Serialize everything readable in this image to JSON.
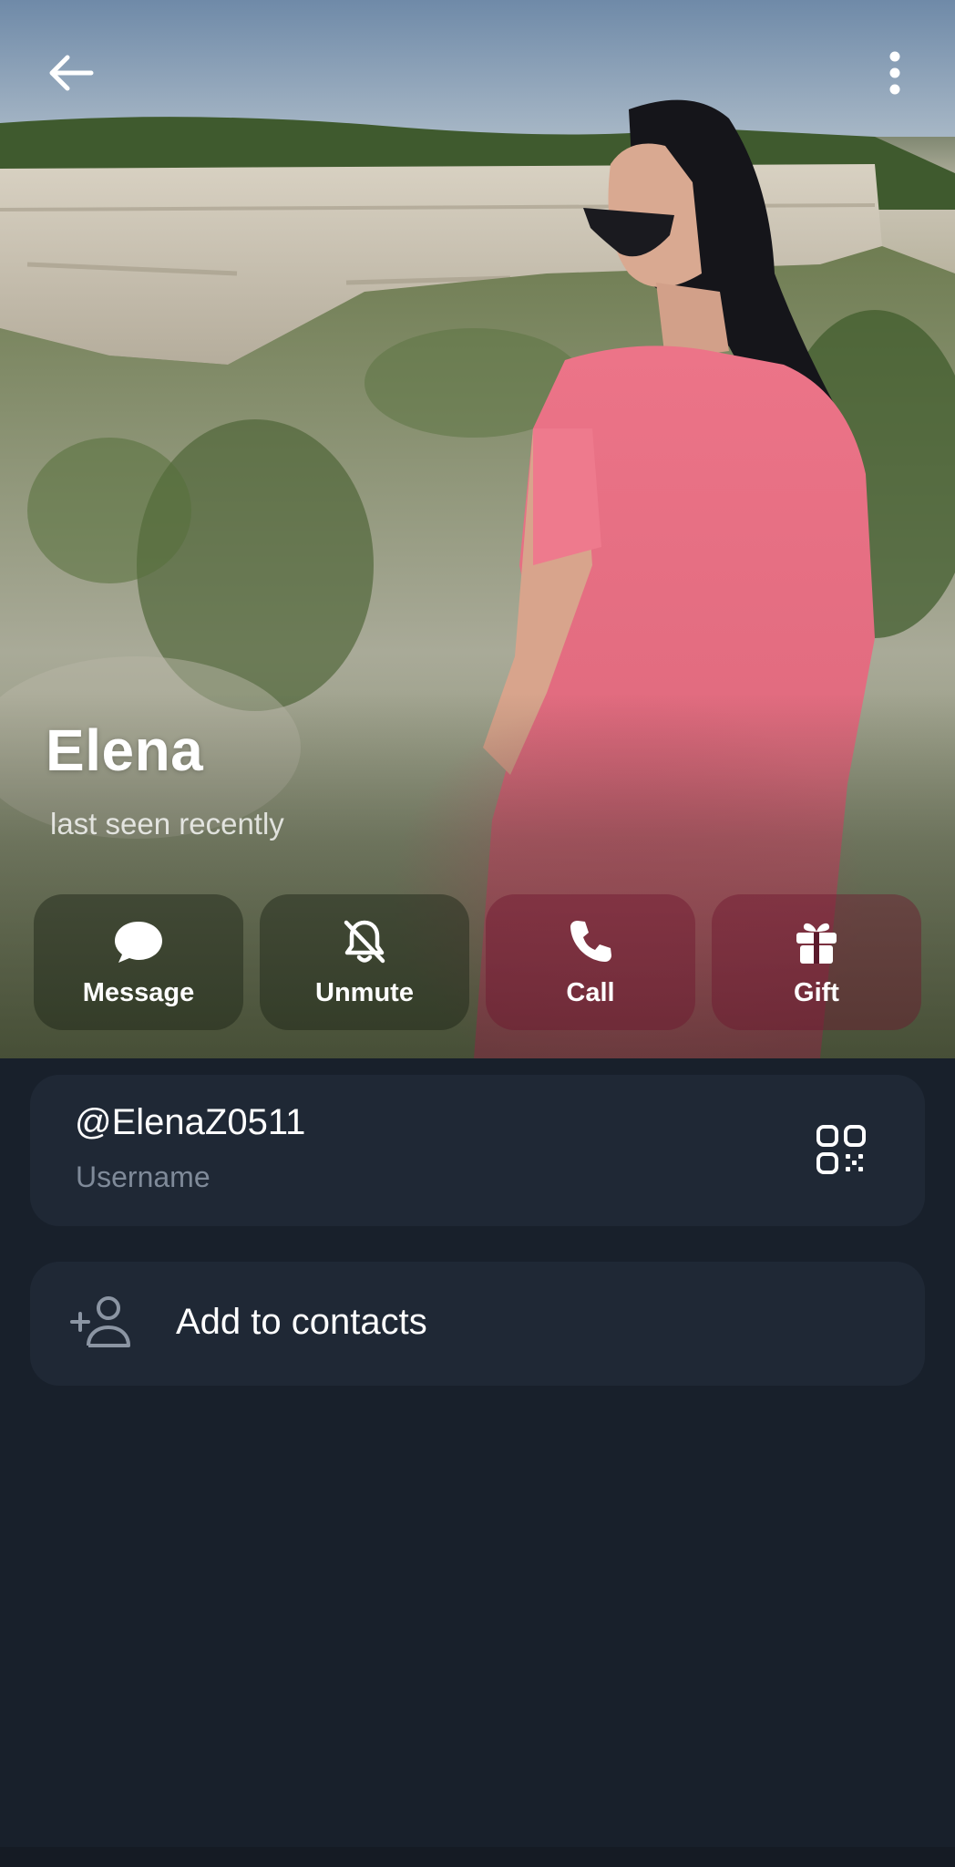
{
  "profile": {
    "name": "Elena",
    "status": "last seen recently"
  },
  "header": {
    "back_icon": "arrow-left-icon",
    "menu_icon": "more-vertical-icon"
  },
  "actions": [
    {
      "label": "Message",
      "icon": "chat-bubble-icon"
    },
    {
      "label": "Unmute",
      "icon": "bell-off-icon"
    },
    {
      "label": "Call",
      "icon": "phone-icon"
    },
    {
      "label": "Gift",
      "icon": "gift-icon"
    }
  ],
  "info": {
    "username": "@ElenaZ0511",
    "username_label": "Username",
    "qr_icon": "qr-code-icon"
  },
  "add_contact": {
    "label": "Add to contacts",
    "icon": "add-person-icon"
  },
  "colors": {
    "background": "#18202b",
    "card": "#1f2835",
    "secondary_text": "#7f8a99",
    "shirt_pink": "#e86f83"
  }
}
